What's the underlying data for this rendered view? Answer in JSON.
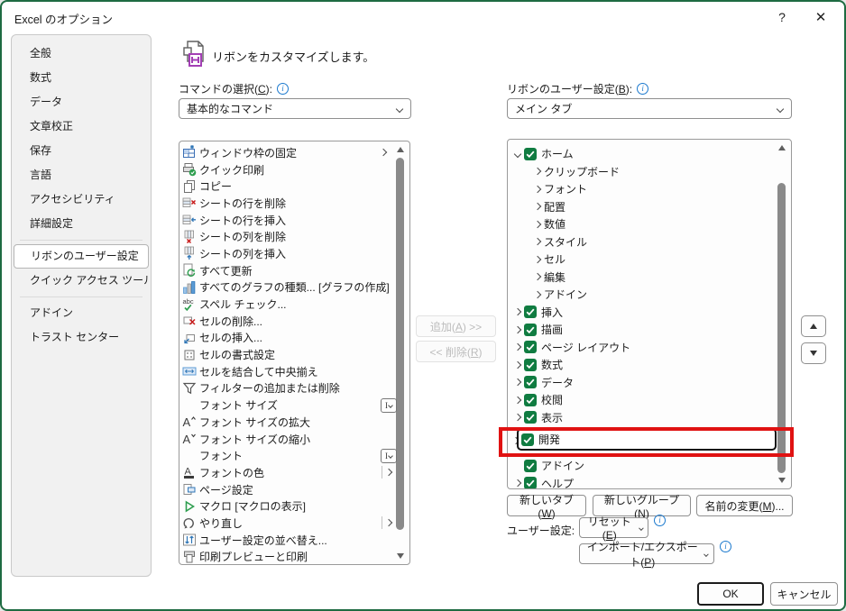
{
  "window": {
    "title": "Excel のオプション",
    "help_label": "?",
    "close_label": "✕"
  },
  "sidebar": {
    "items": [
      {
        "label": "全般"
      },
      {
        "label": "数式"
      },
      {
        "label": "データ"
      },
      {
        "label": "文章校正"
      },
      {
        "label": "保存"
      },
      {
        "label": "言語"
      },
      {
        "label": "アクセシビリティ"
      },
      {
        "label": "詳細設定"
      },
      {
        "label": "リボンのユーザー設定",
        "selected": true,
        "separator_before": true
      },
      {
        "label": "クイック アクセス ツール バー"
      },
      {
        "label": "アドイン",
        "separator_before": true
      },
      {
        "label": "トラスト センター"
      }
    ]
  },
  "header": {
    "title": "リボンをカスタマイズします。"
  },
  "left_panel": {
    "label": "コマンドの選択(C):",
    "selected_option": "基本的なコマンド",
    "commands": [
      {
        "icon": "freeze-panes",
        "label": "ウィンドウ枠の固定",
        "trailing": "chevron"
      },
      {
        "icon": "quick-print",
        "label": "クイック印刷"
      },
      {
        "icon": "copy",
        "label": "コピー"
      },
      {
        "icon": "delete-sheet-rows",
        "label": "シートの行を削除"
      },
      {
        "icon": "insert-sheet-rows",
        "label": "シートの行を挿入"
      },
      {
        "icon": "delete-sheet-columns",
        "label": "シートの列を削除"
      },
      {
        "icon": "insert-sheet-columns",
        "label": "シートの列を挿入"
      },
      {
        "icon": "refresh-all",
        "label": "すべて更新"
      },
      {
        "icon": "chart",
        "label": "すべてのグラフの種類... [グラフの作成]"
      },
      {
        "icon": "spell-check",
        "label": "スペル チェック..."
      },
      {
        "icon": "delete-cells",
        "label": "セルの削除..."
      },
      {
        "icon": "insert-cells",
        "label": "セルの挿入..."
      },
      {
        "icon": "format-cells",
        "label": "セルの書式設定"
      },
      {
        "icon": "merge-center",
        "label": "セルを結合して中央揃え"
      },
      {
        "icon": "filter",
        "label": "フィルターの追加または削除"
      },
      {
        "icon": "none",
        "label": "フォント サイズ",
        "trailing": "combo"
      },
      {
        "icon": "grow-font",
        "label": "フォント サイズの拡大"
      },
      {
        "icon": "shrink-font",
        "label": "フォント サイズの縮小"
      },
      {
        "icon": "none",
        "label": "フォント",
        "trailing": "combo"
      },
      {
        "icon": "font-color",
        "label": "フォントの色",
        "trailing": "split"
      },
      {
        "icon": "page-setup",
        "label": "ページ設定"
      },
      {
        "icon": "macro",
        "label": "マクロ [マクロの表示]"
      },
      {
        "icon": "redo",
        "label": "やり直し",
        "trailing": "split"
      },
      {
        "icon": "custom-sort",
        "label": "ユーザー設定の並べ替え..."
      },
      {
        "icon": "print-preview",
        "label": "印刷プレビューと印刷"
      }
    ]
  },
  "center": {
    "add_label": "追加(A) >>",
    "remove_label": "<< 削除(R)"
  },
  "right_panel": {
    "label": "リボンのユーザー設定(B):",
    "selected_option": "メイン タブ",
    "tree": [
      {
        "label": "ホーム",
        "type": "tab",
        "expanded": true,
        "checked": true
      },
      {
        "label": "クリップボード",
        "type": "group"
      },
      {
        "label": "フォント",
        "type": "group"
      },
      {
        "label": "配置",
        "type": "group"
      },
      {
        "label": "数値",
        "type": "group"
      },
      {
        "label": "スタイル",
        "type": "group"
      },
      {
        "label": "セル",
        "type": "group"
      },
      {
        "label": "編集",
        "type": "group"
      },
      {
        "label": "アドイン",
        "type": "group"
      },
      {
        "label": "挿入",
        "type": "tab",
        "checked": true
      },
      {
        "label": "描画",
        "type": "tab",
        "checked": true
      },
      {
        "label": "ページ レイアウト",
        "type": "tab",
        "checked": true
      },
      {
        "label": "数式",
        "type": "tab",
        "checked": true
      },
      {
        "label": "データ",
        "type": "tab",
        "checked": true
      },
      {
        "label": "校閲",
        "type": "tab",
        "checked": true
      },
      {
        "label": "表示",
        "type": "tab",
        "checked": true
      },
      {
        "label": "開発",
        "type": "tab",
        "checked": true,
        "focused": true,
        "annotated": true
      },
      {
        "label": "アドイン",
        "type": "tab",
        "checked": true,
        "no_chevron": true
      },
      {
        "label": "ヘルプ",
        "type": "tab",
        "checked": true
      }
    ],
    "new_tab_label": "新しいタブ(W)",
    "new_group_label": "新しいグループ(N)",
    "rename_label": "名前の変更(M)...",
    "customizations_label": "ユーザー設定:",
    "reset_label": "リセット(E)",
    "import_export_label": "インポート/エクスポート(P)"
  },
  "footer": {
    "ok_label": "OK",
    "cancel_label": "キャンセル"
  },
  "annotation": {
    "color": "#e01212"
  },
  "colors": {
    "accent_green": "#107c41",
    "info_blue": "#1b79ce",
    "window_border": "#1e6b42"
  }
}
